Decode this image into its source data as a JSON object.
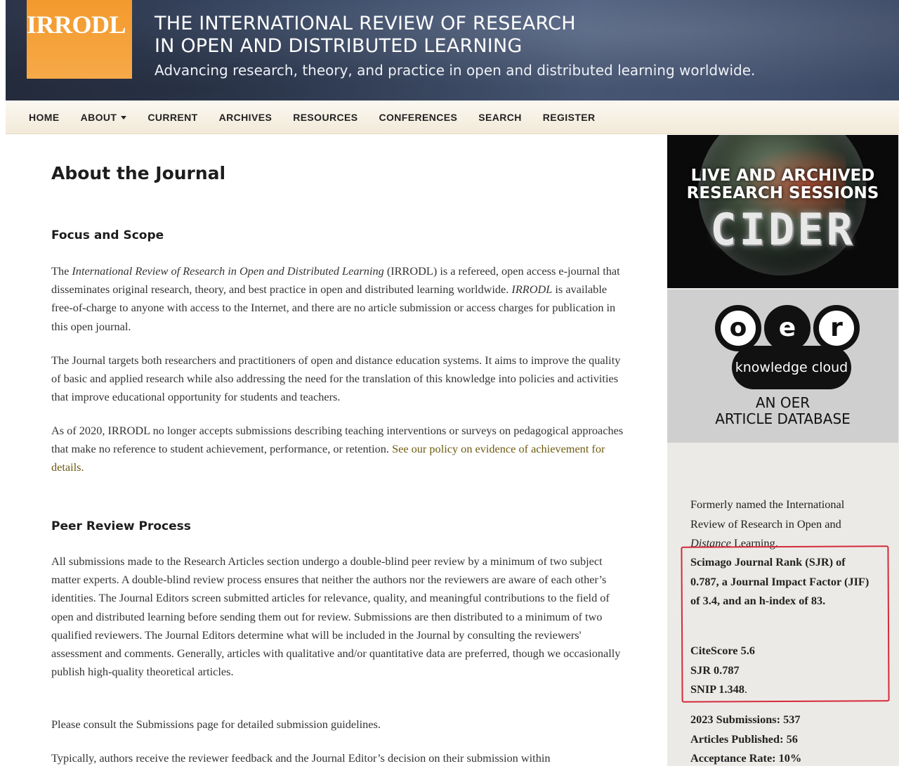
{
  "banner": {
    "logo": "IRRODL",
    "title_line1": "THE INTERNATIONAL REVIEW OF RESEARCH",
    "title_line2": "IN OPEN AND DISTRIBUTED LEARNING",
    "tagline": "Advancing research, theory, and practice in open and distributed learning worldwide."
  },
  "nav": {
    "home": "HOME",
    "about": "ABOUT",
    "current": "CURRENT",
    "archives": "ARCHIVES",
    "resources": "RESOURCES",
    "conferences": "CONFERENCES",
    "search": "SEARCH",
    "register": "REGISTER"
  },
  "main": {
    "title": "About the Journal",
    "focus_heading": "Focus and Scope",
    "p1_a": "The ",
    "p1_journal": "International Review of Research in Open and Distributed Learning",
    "p1_b": " (IRRODL) is a refereed, open access e-journal that disseminates original research, theory, and best practice in open and distributed learning worldwide. ",
    "p1_irrodl": "IRRODL",
    "p1_c": " is available free-of-charge to anyone with access to the Internet, and there are no article submission or access charges for publication in this open journal.",
    "p2": "The Journal targets both researchers and practitioners of open and distance education systems. It aims to improve the quality of basic and applied research while also addressing the need for the translation of this knowledge into policies and activities that improve educational opportunity for students and teachers.",
    "p3_a": "As of 2020, IRRODL no longer accepts submissions describing teaching interventions or surveys on pedagogical approaches that make no reference to student achievement, performance, or retention. ",
    "p3_link": "See our policy on evidence of achievement for details.",
    "peer_heading": "Peer Review Process",
    "p4": "All submissions made to the Research Articles section undergo a double-blind peer review by a minimum of two subject matter experts. A double-blind review process ensures that neither the authors nor the reviewers are aware of each other’s identities. The Journal Editors screen submitted articles for relevance, quality, and meaningful contributions to the field of open and distributed learning before sending them out for review. Submissions are then distributed to a minimum of two qualified reviewers. The Journal Editors determine what will be included in the Journal by consulting the reviewers' assessment and comments. Generally, articles with qualitative and/or quantitative data are preferred, though we occasionally publish high-quality theoretical articles.",
    "p5": "Please consult the Submissions page for detailed submission guidelines.",
    "p6": "Typically, authors receive the reviewer feedback and the Journal Editor’s decision on their submission within"
  },
  "sidebar": {
    "cider_heading_1": "LIVE AND ARCHIVED",
    "cider_heading_2": "RESEARCH SESSIONS",
    "cider_word": "CIDER",
    "oer_o": "o",
    "oer_e": "e",
    "oer_r": "r",
    "oer_pill": "knowledge cloud",
    "oer_caption_1": "AN OER",
    "oer_caption_2": "ARTICLE DATABASE",
    "formerly_a": "Formerly named the International Review of Research in Open and ",
    "formerly_distance": "Distance",
    "formerly_b": " Learning.",
    "sjr_sentence": "Scimago Journal Rank (SJR) of 0.787, a Journal Impact Factor (JIF) of 3.4, and an h-index of 83.",
    "citescore": "CiteScore 5.6",
    "sjr": "SJR 0.787",
    "snip": "SNIP 1.348",
    "snip_period": ".",
    "submissions": "2023 Submissions: 537",
    "published": "Articles Published: 56",
    "acceptance": "Acceptance Rate: 10%"
  },
  "colors": {
    "logo_orange": "#f39a2d",
    "link": "#6e5a10",
    "highlight_box": "#d42a3a"
  }
}
